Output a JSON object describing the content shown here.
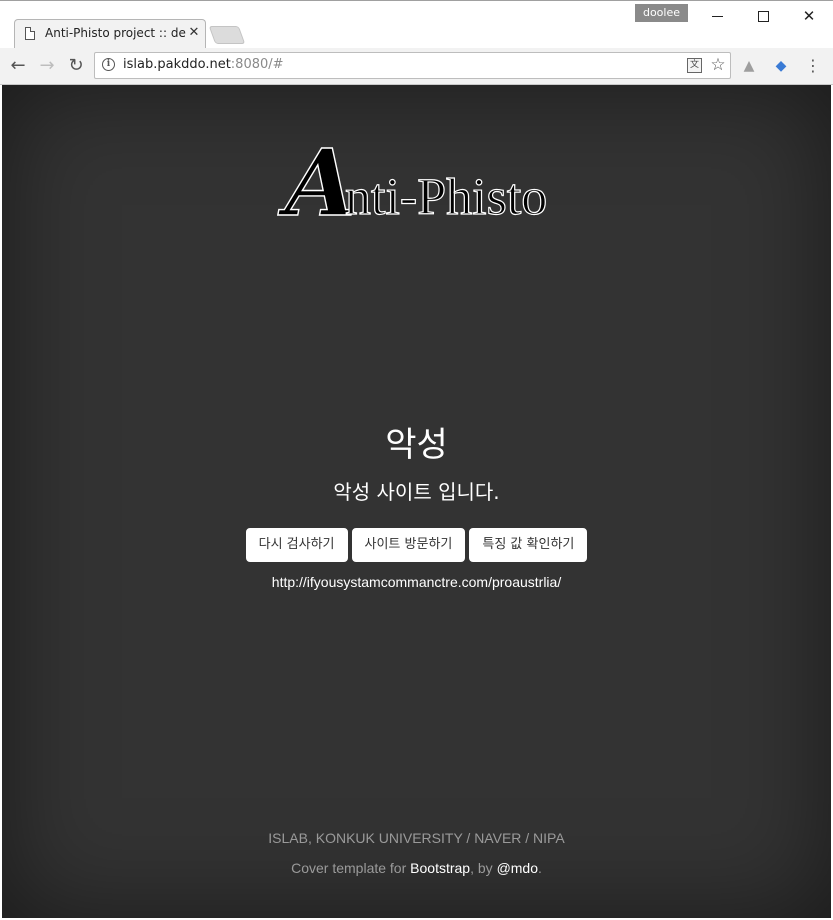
{
  "browser": {
    "tab_title": "Anti-Phisto project :: de",
    "profile_name": "doolee",
    "url_host": "islab.pakddo.net",
    "url_rest": ":8080/#"
  },
  "page": {
    "logo_initial": "A",
    "logo_rest": "nti-Phisto",
    "result_title": "악성",
    "result_message": "악성 사이트 입니다.",
    "buttons": {
      "rescan": "다시 검사하기",
      "visit": "사이트 방문하기",
      "features": "특징 값 확인하기"
    },
    "checked_url": "http://ifyousystamcommanctre.com/proaustrlia/",
    "footer_line1": "ISLAB, KONKUK UNIVERSITY / NAVER / NIPA",
    "footer_prefix": "Cover template for ",
    "footer_link_bootstrap": "Bootstrap",
    "footer_mid": ", by ",
    "footer_link_mdo": "@mdo",
    "footer_suffix": "."
  },
  "icons": {
    "tab": "document-icon",
    "back": "back-arrow-icon",
    "forward": "forward-arrow-icon",
    "reload": "reload-icon",
    "info": "info-icon",
    "translate": "translate-icon",
    "bookmark": "star-icon",
    "menu": "kebab-menu-icon"
  },
  "colors": {
    "page_background": "#333333",
    "button_background": "#ffffff",
    "footer_text": "#9a9a9a"
  }
}
